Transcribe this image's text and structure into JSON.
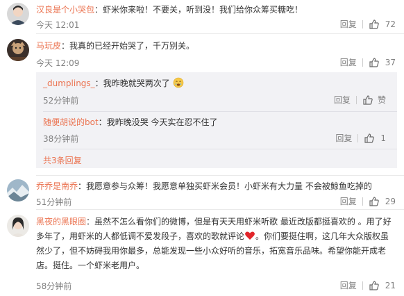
{
  "colors": {
    "accent": "#eb7350",
    "muted": "#808080",
    "sub_bg": "#f2f2f5"
  },
  "reply_label": "回复",
  "comments": [
    {
      "user": "汉良是个小哭包",
      "sep": "：",
      "lines": [
        "虾米你来啦！不要关，听到没！我们给你众筹买糖吃！"
      ],
      "time": "今天 12:01",
      "likes": "72"
    },
    {
      "user": "马玩皮",
      "sep": "：",
      "lines": [
        "我真的已经开始哭了，千万别关。"
      ],
      "time": "今天 12:09",
      "likes": "37",
      "replies": [
        {
          "user": "_dumplings_",
          "sep": "：",
          "text": "我昨晚就哭两次了",
          "emoji": "crying-emoji",
          "time": "52分钟前",
          "likes": "赞"
        },
        {
          "user": "随便胡说的bot",
          "sep": "：",
          "text": "我昨晚没哭 今天实在忍不住了",
          "time": "38分钟前",
          "likes": "1"
        }
      ],
      "more": "共3条回复"
    },
    {
      "user": "乔乔是南乔",
      "sep": "：",
      "lines": [
        "我愿意参与众筹！我愿意单独买虾米会员！小虾米有大力量 不会被鲸鱼吃掉的"
      ],
      "time": "51分钟前",
      "likes": "29"
    },
    {
      "user": "黑夜的黑眼圈",
      "sep": "：",
      "lines": [
        "虽然不怎么看你们的微博，但是有天天用虾米听歌 最近改版都挺喜欢的 。用了好",
        "多年了，用虾米的人都低调不爱发段子，喜欢的歌就评论",
        "。你们要挺住啊，这几年大众版权虽",
        "然少了，但不妨碍我用你最多，总能发现一些小众好听的音乐，拓宽音乐品味。希望你能开成老",
        "店。挺住。一个虾米老用户。"
      ],
      "heart": "heart-emoji",
      "time": "58分钟前",
      "likes": "21"
    }
  ]
}
